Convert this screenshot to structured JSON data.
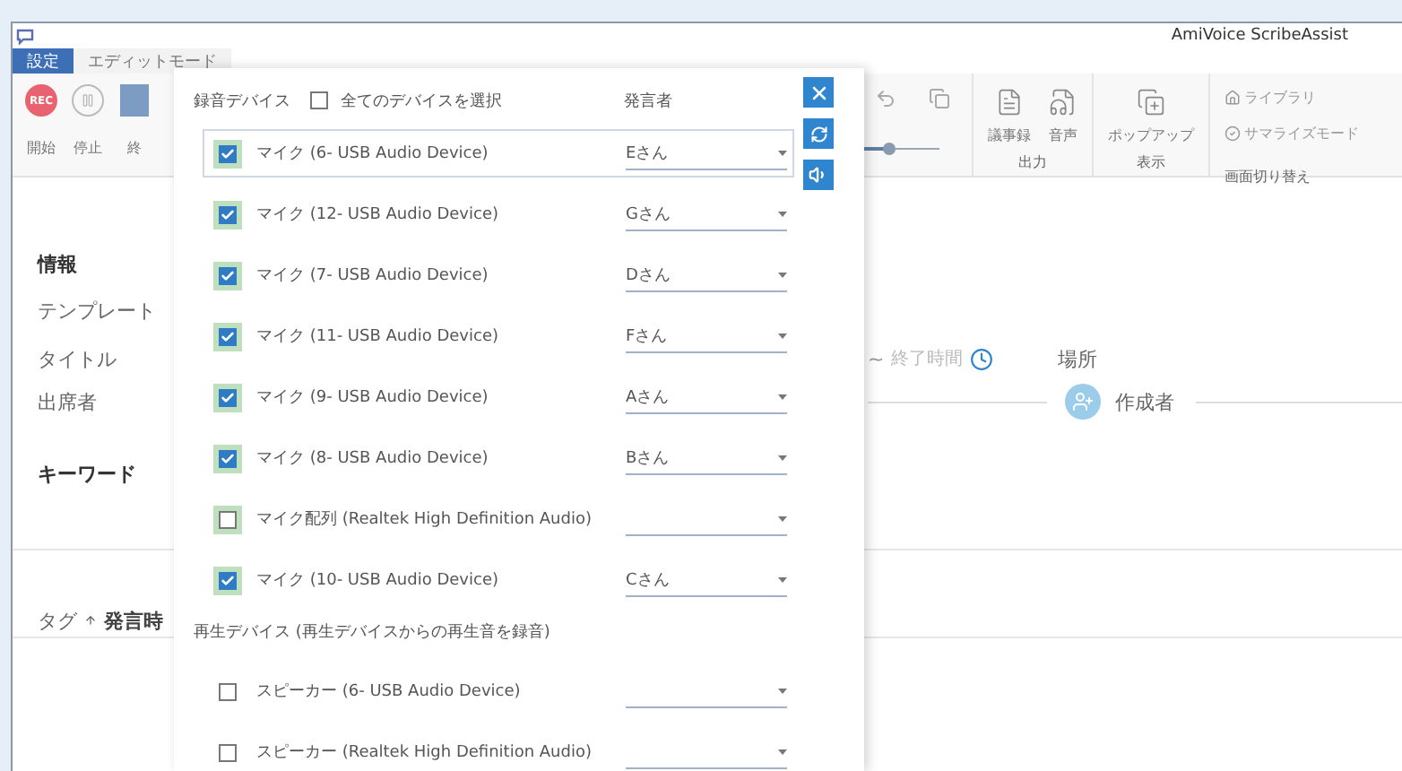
{
  "window": {
    "app_title": "AmiVoice ScribeAssist"
  },
  "tabs": [
    {
      "label": "設定",
      "selected": true
    },
    {
      "label": "エディットモード",
      "selected": false
    }
  ],
  "ribbon": {
    "rec_label": "REC",
    "record_buttons": [
      {
        "kind": "rec",
        "label": "開始"
      },
      {
        "kind": "pause",
        "label": "停止"
      },
      {
        "kind": "end",
        "label": "終"
      }
    ],
    "groups": [
      {
        "kind": "buttons",
        "title": "出力",
        "items": [
          "議事録",
          "音声"
        ]
      },
      {
        "kind": "buttons",
        "title": "表示",
        "items": [
          "ポップアップ"
        ]
      },
      {
        "kind": "links",
        "title": "画面切り替え",
        "items": [
          "ライブラリ",
          "サマライズモード"
        ]
      }
    ]
  },
  "info": {
    "heading": "情報",
    "template_label": "テンプレート",
    "title_label": "タイトル",
    "attendees_label": "出席者",
    "time_separator": "~",
    "end_time_placeholder": "終了時間",
    "location_label": "場所",
    "author_label": "作成者"
  },
  "keyword_label": "キーワード",
  "table_header": {
    "column_1": "タグ",
    "column_2": "発言時"
  },
  "dialog": {
    "recording_title": "録音デバイス",
    "select_all": {
      "label": "全てのデバイスを選択",
      "checked": false
    },
    "speaker_header": "発言者",
    "recording_devices": [
      {
        "name": "マイク (6- USB Audio Device)",
        "checked": true,
        "speaker": "Eさん",
        "focused": true
      },
      {
        "name": "マイク (12- USB Audio Device)",
        "checked": true,
        "speaker": "Gさん",
        "focused": false
      },
      {
        "name": "マイク (7- USB Audio Device)",
        "checked": true,
        "speaker": "Dさん",
        "focused": false
      },
      {
        "name": "マイク (11- USB Audio Device)",
        "checked": true,
        "speaker": "Fさん",
        "focused": false
      },
      {
        "name": "マイク (9- USB Audio Device)",
        "checked": true,
        "speaker": "Aさん",
        "focused": false
      },
      {
        "name": "マイク (8- USB Audio Device)",
        "checked": true,
        "speaker": "Bさん",
        "focused": false
      },
      {
        "name": "マイク配列 (Realtek High Definition Audio)",
        "checked": false,
        "focused": false
      },
      {
        "name": "マイク (10- USB Audio Device)",
        "checked": true,
        "speaker": "Cさん",
        "focused": false
      }
    ],
    "playback_title": "再生デバイス (再生デバイスからの再生音を録音)",
    "playback_devices": [
      {
        "name": "スピーカー (6- USB Audio Device)",
        "checked": false,
        "focused": false
      },
      {
        "name": "スピーカー (Realtek High Definition Audio)",
        "checked": false,
        "focused": false
      }
    ]
  }
}
